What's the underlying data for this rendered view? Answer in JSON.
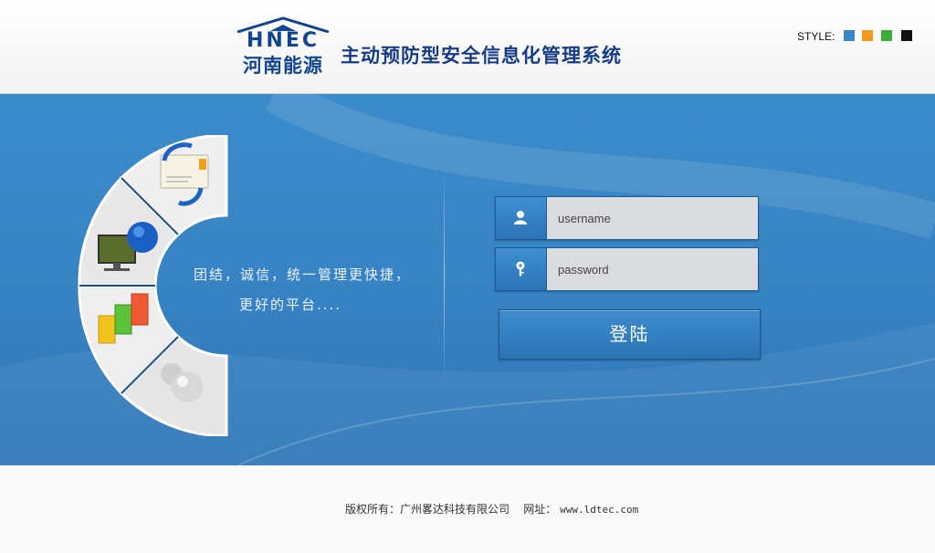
{
  "header": {
    "logo_en": "HNEC",
    "logo_cn": "河南能源",
    "system_title": "主动预防型安全信息化管理系统",
    "style_label": "STYLE:",
    "style_swatches": [
      {
        "name": "blue",
        "color": "#3b87c8"
      },
      {
        "name": "orange",
        "color": "#f39a1e"
      },
      {
        "name": "green",
        "color": "#3aae3a"
      },
      {
        "name": "black",
        "color": "#111111"
      }
    ]
  },
  "banner": {
    "tagline_line1": "团结，诚信，统一管理更快捷，",
    "tagline_line2": "更好的平台....",
    "fan_icons": [
      "email-sync-icon",
      "computer-globe-icon",
      "bar-chart-icon",
      "spheres-icon"
    ]
  },
  "login": {
    "username_placeholder": "username",
    "password_placeholder": "password",
    "login_label": "登陆"
  },
  "footer": {
    "copyright_prefix": "版权所有：广州畧达科技有限公司",
    "website_label": "网址：",
    "website": "www.ldtec.com"
  }
}
